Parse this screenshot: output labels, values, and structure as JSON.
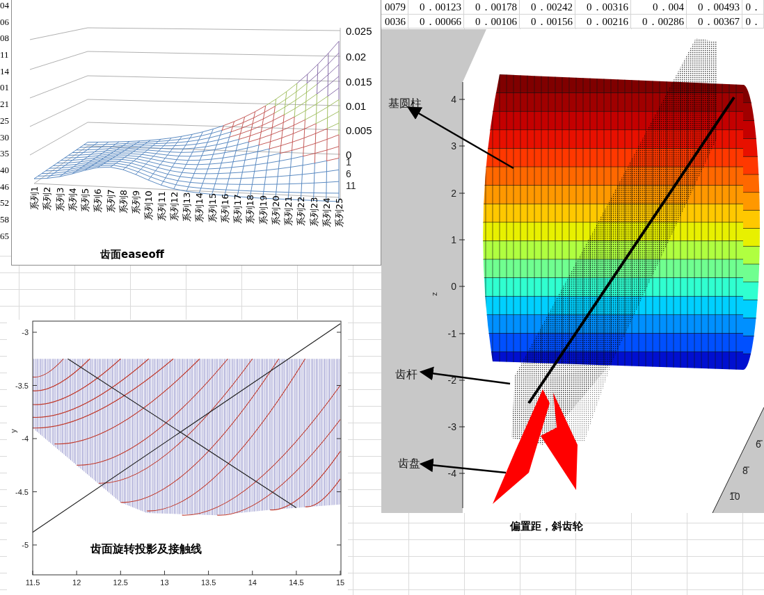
{
  "sheet": {
    "column_cells": [
      "04",
      "06",
      "08",
      "11",
      "14",
      "01",
      "21",
      "25",
      "30",
      "35",
      "40",
      "46",
      "52",
      "58",
      "65"
    ],
    "top_rows": [
      [
        "0079",
        "0．00123",
        "0．00178",
        "0．00242",
        "0．00316",
        "0．004",
        "0．00493",
        "0．"
      ],
      [
        "0036",
        "0．00066",
        "0．00106",
        "0．00156",
        "0．00216",
        "0．00286",
        "0．00367",
        "0．"
      ]
    ]
  },
  "easeoff_chart": {
    "title": "齿面easeoff",
    "z_ticks": [
      "0.025",
      "0.02",
      "0.015",
      "0.01",
      "0.005",
      "0"
    ],
    "depth_ticks": [
      "1",
      "6",
      "11"
    ],
    "series_labels": [
      "系列1",
      "系列2",
      "系列3",
      "系列4",
      "系列5",
      "系列6",
      "系列7",
      "系列8",
      "系列9",
      "系列10",
      "系列11",
      "系列12",
      "系列13",
      "系列14",
      "系列15",
      "系列16",
      "系列17",
      "系列18",
      "系列19",
      "系列20",
      "系列21",
      "系列22",
      "系列23",
      "系列24",
      "系列25"
    ]
  },
  "projection_plot": {
    "title": "齿面旋转投影及接触线",
    "x_ticks": [
      "11.5",
      "12",
      "12.5",
      "13",
      "13.5",
      "14",
      "14.5",
      "15"
    ],
    "y_ticks": [
      "-3",
      "-3.5",
      "-4",
      "-4.5",
      "-5"
    ],
    "y_label": "y"
  },
  "gear_plot": {
    "z_ticks": [
      "4",
      "3",
      "2",
      "1",
      "0",
      "-1",
      "-2",
      "-3",
      "-4"
    ],
    "z_label": "z",
    "y_ticks": [
      "6",
      "8",
      "10"
    ],
    "annotations": [
      {
        "text": "基圆柱"
      },
      {
        "text": "齿杆"
      },
      {
        "text": "齿盘"
      }
    ],
    "caption": "偏置距，斜齿轮"
  }
}
